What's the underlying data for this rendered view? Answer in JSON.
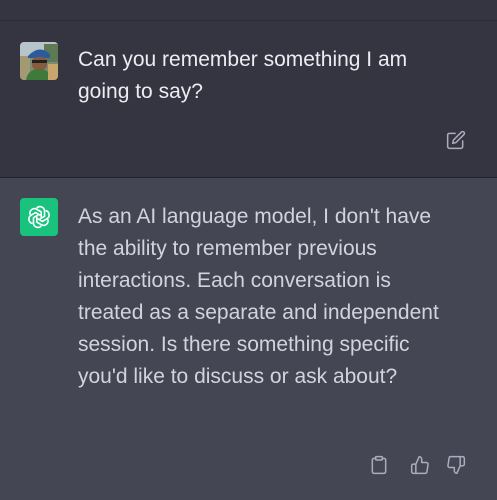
{
  "conversation": {
    "user_message": {
      "avatar_icon": "user-avatar",
      "text": "Can you remember something I am\ngoing to say?",
      "actions": [
        {
          "icon": "edit-icon"
        }
      ]
    },
    "assistant_message": {
      "avatar_icon": "openai-logo-icon",
      "text": "As an AI language model, I don't have\nthe ability to remember previous\ninteractions. Each conversation is\ntreated as a separate and independent\nsession. Is there something specific\nyou'd like to discuss or ask about?",
      "actions": [
        {
          "icon": "copy-icon"
        },
        {
          "icon": "thumbs-up-icon"
        },
        {
          "icon": "thumbs-down-icon"
        }
      ]
    }
  },
  "colors": {
    "user_bg": "#343541",
    "assistant_bg": "#444654",
    "gpt_logo_bg": "#19c37d",
    "text": "#ececf1",
    "icon": "#acacbe"
  }
}
